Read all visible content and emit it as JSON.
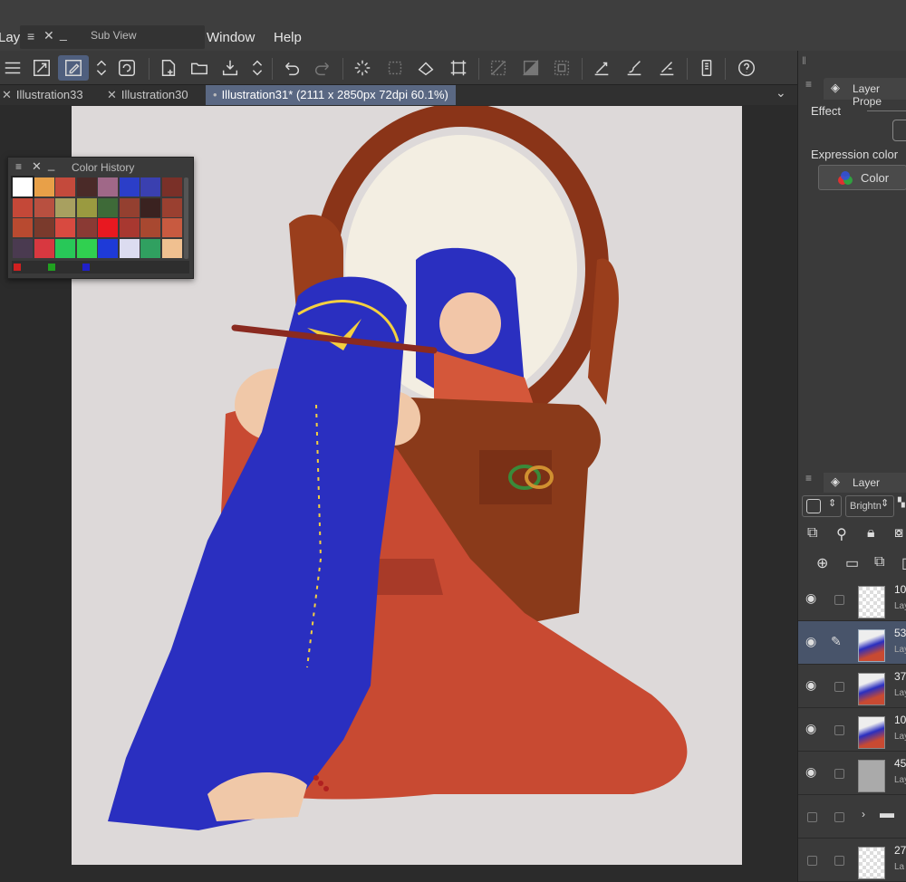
{
  "menubar": {
    "partial_left": "Laye",
    "subview_title": "Sub View",
    "window_label": "Window",
    "help_label": "Help"
  },
  "tabs": [
    {
      "label": "Illustration33"
    },
    {
      "label": "Illustration30"
    },
    {
      "label": "Illustration31* (2111 x 2850px 72dpi 60.1%)"
    }
  ],
  "color_history": {
    "title": "Color History",
    "swatches": [
      "#ffffff",
      "#e8a048",
      "#c44a3c",
      "#4a2a28",
      "#a06888",
      "#2b3ec8",
      "#3a40b0",
      "#7a3028",
      "#c44838",
      "#b85040",
      "#a8a060",
      "#9a9a40",
      "#3e6a38",
      "#944030",
      "#3a2220",
      "#9a4030",
      "#b84a30",
      "#7a3a2c",
      "#d84a40",
      "#8a3a34",
      "#e81820",
      "#a83830",
      "#a84830",
      "#c85a40",
      "#4a3a50",
      "#d83840",
      "#28c858",
      "#30d050",
      "#1e3ad8",
      "#dcdcf0",
      "#30a060",
      "#f0c090"
    ],
    "bottom": [
      "#d02020",
      "#20a020",
      "#2020c8"
    ]
  },
  "right_panel": {
    "layer_property_title": "Layer Prope",
    "effect_label": "Effect",
    "expression_color_label": "Expression color",
    "color_button": "Color",
    "layer_title": "Layer",
    "blend_mode": "Brightn",
    "layers": [
      {
        "num": "10",
        "sub": "Lay",
        "visible": true,
        "selected": false,
        "thumb": "empty"
      },
      {
        "num": "53",
        "sub": "Lay",
        "visible": true,
        "selected": true,
        "thumb": "art"
      },
      {
        "num": "37",
        "sub": "Lay",
        "visible": true,
        "selected": false,
        "thumb": "art"
      },
      {
        "num": "10",
        "sub": "Lay",
        "visible": true,
        "selected": false,
        "thumb": "art"
      },
      {
        "num": "45",
        "sub": "Lay",
        "visible": true,
        "selected": false,
        "thumb": "gray"
      },
      {
        "num": "",
        "sub": "",
        "visible": false,
        "selected": false,
        "thumb": "folder"
      },
      {
        "num": "27",
        "sub": "La",
        "visible": false,
        "selected": false,
        "thumb": "empty"
      }
    ]
  },
  "colors": {
    "accent": "#5a6883",
    "canvas_bg": "#ddd9d9",
    "hair": "#2a2fc0",
    "dress": "#c84a32",
    "wood": "#8a3a1a"
  }
}
